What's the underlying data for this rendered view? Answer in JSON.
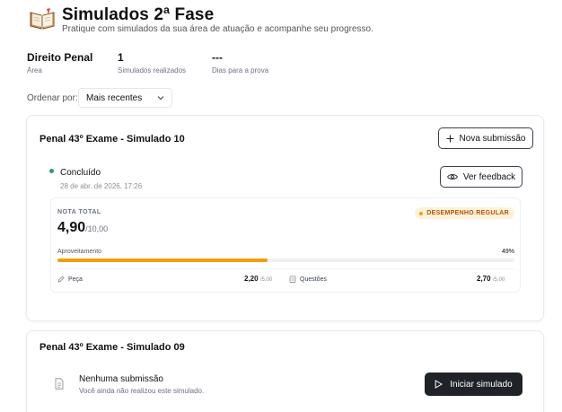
{
  "header": {
    "title": "Simulados 2ª Fase",
    "subtitle": "Pratique com simulados da sua área de atuação e acompanhe seu progresso."
  },
  "stats": [
    {
      "value": "Direito Penal",
      "label": "Área"
    },
    {
      "value": "1",
      "label": "Simulados realizados"
    },
    {
      "value": "---",
      "label": "Dias para a prova"
    }
  ],
  "sort": {
    "label": "Ordenar por:",
    "selected": "Mais recentes"
  },
  "exams": [
    {
      "title": "Penal 43º Exame - Simulado 10",
      "new_submission_label": "Nova submissão",
      "status": "Concluído",
      "date": "28 de abr. de 2026, 17:26",
      "feedback_label": "Ver feedback",
      "grade_label": "NOTA TOTAL",
      "grade": "4,90",
      "grade_max": "/10,00",
      "performance_badge": "DESEMPENHO REGULAR",
      "progress_label": "Aproveitamento",
      "progress_pct": 49,
      "progress_text": "49%",
      "criteria": [
        {
          "label": "Peça",
          "score": "2,20",
          "max": "/5,00",
          "icon": "pen-icon"
        },
        {
          "label": "Questões",
          "score": "2,70",
          "max": "/5,00",
          "icon": "list-icon"
        }
      ]
    },
    {
      "title": "Penal 43º Exame - Simulado 09",
      "empty_title": "Nenhuma submissão",
      "empty_sub": "Você ainda não realizou este simulado.",
      "start_label": "Iniciar simulado"
    }
  ],
  "colors": {
    "accent_orange": "#f59e0b",
    "status_green": "#22a06b",
    "dark_button": "#1f2328"
  }
}
